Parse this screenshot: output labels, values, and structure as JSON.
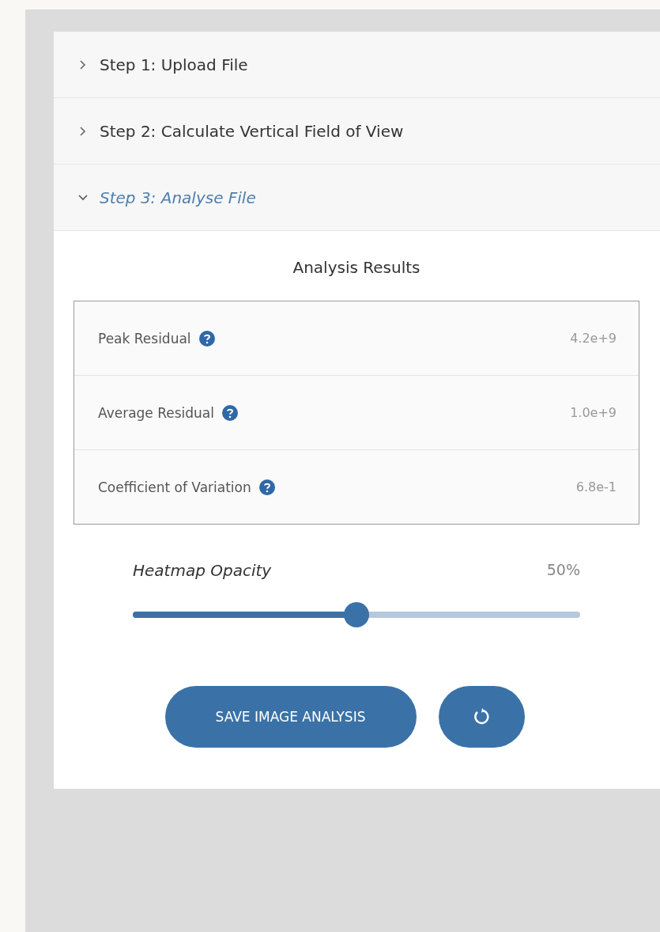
{
  "steps": [
    {
      "title": "Step 1: Upload File",
      "expanded": false
    },
    {
      "title": "Step 2: Calculate Vertical Field of View",
      "expanded": false
    },
    {
      "title": "Step 3: Analyse File",
      "expanded": true
    }
  ],
  "results": {
    "title": "Analysis Results",
    "rows": [
      {
        "label": "Peak Residual",
        "value": "4.2e+9"
      },
      {
        "label": "Average Residual",
        "value": "1.0e+9"
      },
      {
        "label": "Coefficient of Variation",
        "value": "6.8e-1"
      }
    ]
  },
  "opacity": {
    "label": "Heatmap Opacity",
    "reading": "50%",
    "level": 0.5
  },
  "buttons": {
    "save": "SAVE IMAGE ANALYSIS"
  }
}
